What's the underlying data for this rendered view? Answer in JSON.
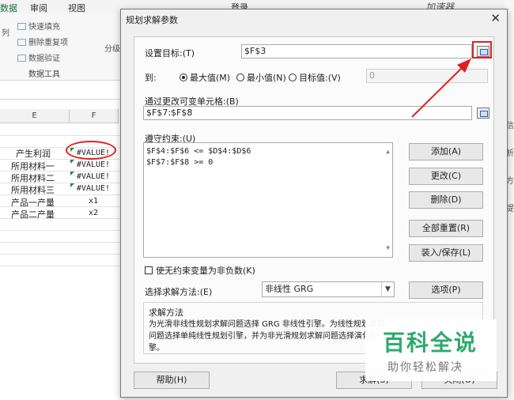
{
  "ribbon": {
    "tabs": [
      "数据",
      "审阅",
      "视图"
    ],
    "login": "登录",
    "accelerator": "加速器",
    "items": [
      "快速填充",
      "删除重复项",
      "数据验证",
      "分级显"
    ],
    "left_fragment": "列",
    "group_label": "数据工具"
  },
  "sheet": {
    "col_e": "E",
    "col_f": "F",
    "rows": [
      {
        "label": "产生利润",
        "value": "#VALUE!"
      },
      {
        "label": "所用材料一",
        "value": "#VALUE!"
      },
      {
        "label": "所用材料二",
        "value": "#VALUE!"
      },
      {
        "label": "所用材料三",
        "value": "#VALUE!"
      },
      {
        "label": "产品一产量",
        "value": "x1"
      },
      {
        "label": "产品二产量",
        "value": "x2"
      }
    ],
    "right_chars": [
      "信",
      "析",
      "方",
      "提"
    ]
  },
  "dialog": {
    "title": "规划求解参数",
    "close": "✕",
    "objective_label": "设置目标:(T)",
    "objective_value": "$F$3",
    "to_label": "到:",
    "radio_max": "最大值(M)",
    "radio_min": "最小值(N)",
    "radio_target": "目标值:(V)",
    "target_value": "0",
    "changing_label": "通过更改可变单元格:(B)",
    "changing_value": "$F$7:$F$8",
    "constraints_label": "遵守约束:(U)",
    "constraints": [
      "$F$4:$F$6 <= $D$4:$D$6",
      "$F$7:$F$8 >= 0"
    ],
    "btn_add": "添加(A)",
    "btn_change": "更改(C)",
    "btn_delete": "删除(D)",
    "btn_reset": "全部重置(R)",
    "btn_load_save": "装入/保存(L)",
    "nonneg_label": "使无约束变量为非负数(K)",
    "method_label": "选择求解方法:(E)",
    "method_value": "非线性 GRG",
    "btn_options": "选项(P)",
    "method_box_title": "求解方法",
    "method_box_text": "为光滑非线性规划求解问题选择 GRG 非线性引擎。为线性规划求解问题选择单纯线性规划引擎，并为非光滑规划求解问题选择演化引擎。",
    "btn_help": "帮助(H)",
    "btn_solve": "求解(S)",
    "btn_close": "关闭(O)"
  },
  "watermark": {
    "big": "百科全说",
    "small": "助你轻松解决"
  },
  "colors": {
    "annotation_red": "#e02020",
    "watermark_green": "#2daa6c",
    "excel_green": "#1d6e3c"
  }
}
